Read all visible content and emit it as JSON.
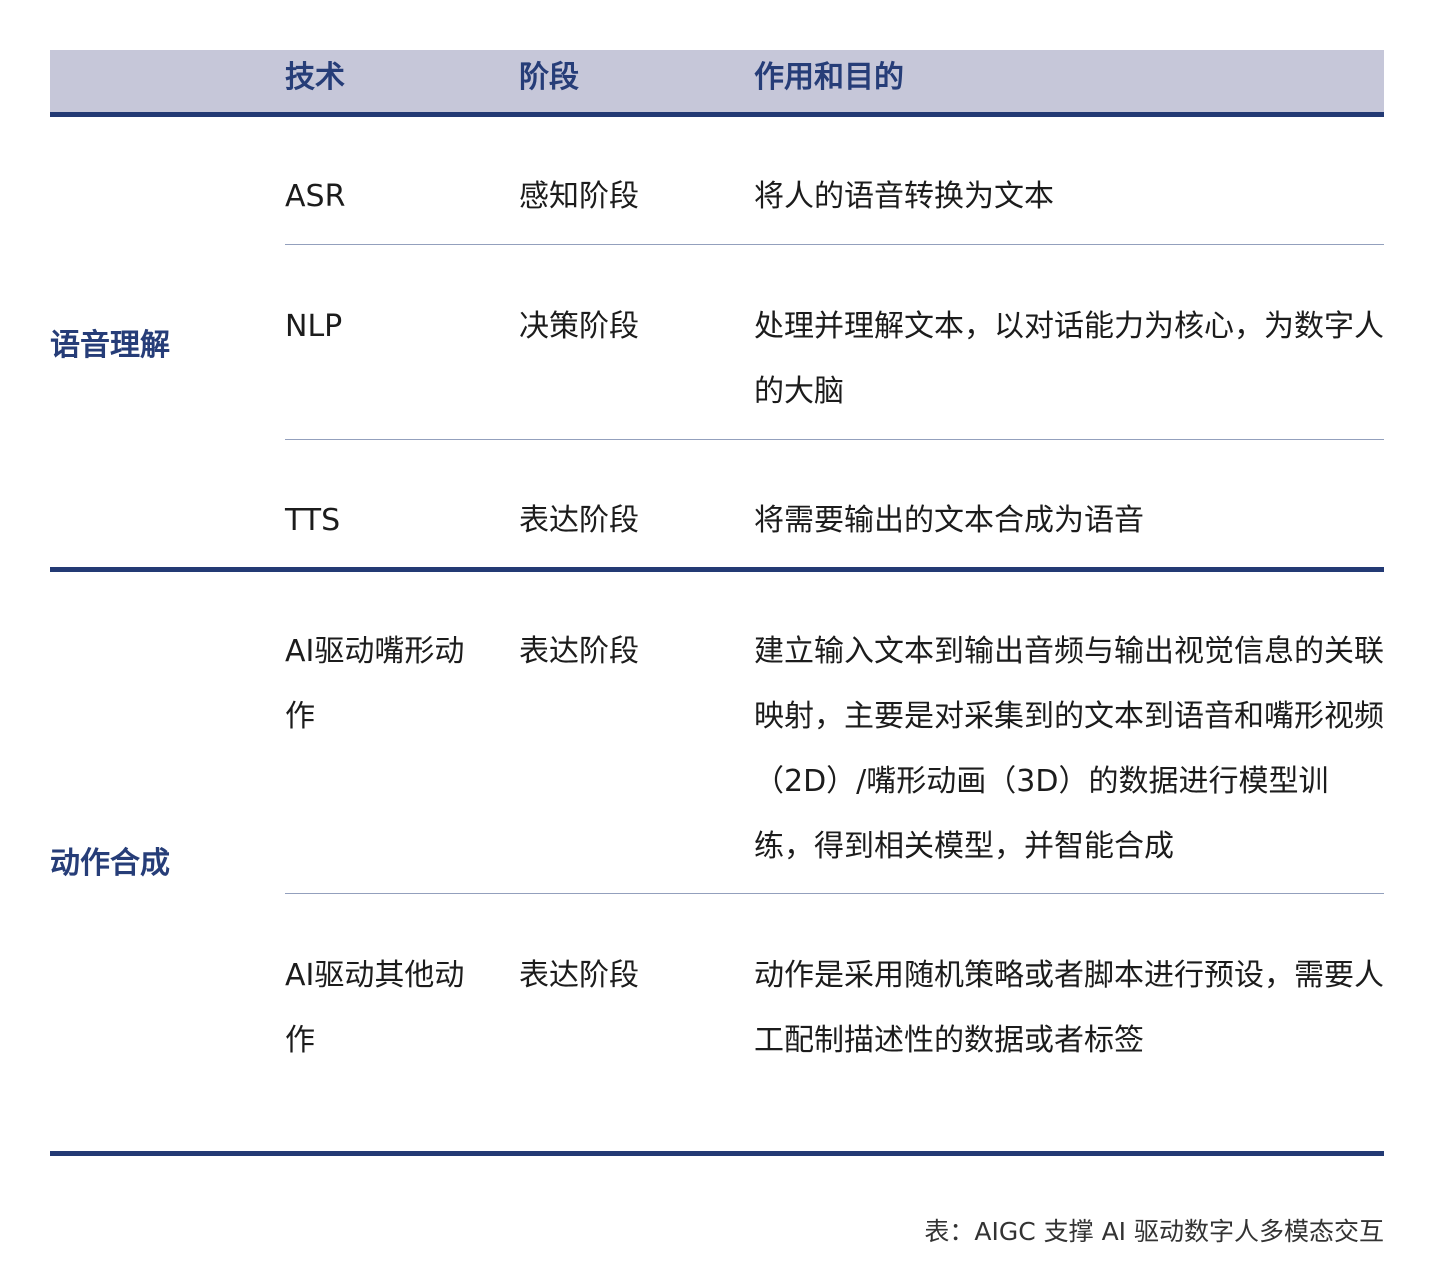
{
  "table": {
    "headers": {
      "tech": "技术",
      "stage": "阶段",
      "purpose": "作用和目的"
    },
    "groups": [
      {
        "category": "语音理解",
        "rows": [
          {
            "tech": "ASR",
            "stage": "感知阶段",
            "purpose": "将人的语音转换为文本"
          },
          {
            "tech": "NLP",
            "stage": "决策阶段",
            "purpose": "处理并理解文本，以对话能力为核心，为数字人的大脑"
          },
          {
            "tech": "TTS",
            "stage": "表达阶段",
            "purpose": "将需要输出的文本合成为语音"
          }
        ]
      },
      {
        "category": "动作合成",
        "rows": [
          {
            "tech": "AI驱动嘴形动作",
            "stage": "表达阶段",
            "purpose": "建立输入文本到输出音频与输出视觉信息的关联映射，主要是对采集到的文本到语音和嘴形视频（2D）/嘴形动画（3D）的数据进行模型训练，得到相关模型，并智能合成"
          },
          {
            "tech": "AI驱动其他动作",
            "stage": "表达阶段",
            "purpose": "动作是采用随机策略或者脚本进行预设，需要人工配制描述性的数据或者标签"
          }
        ]
      }
    ]
  },
  "caption": "表：AIGC 支撑 AI 驱动数字人多模态交互"
}
